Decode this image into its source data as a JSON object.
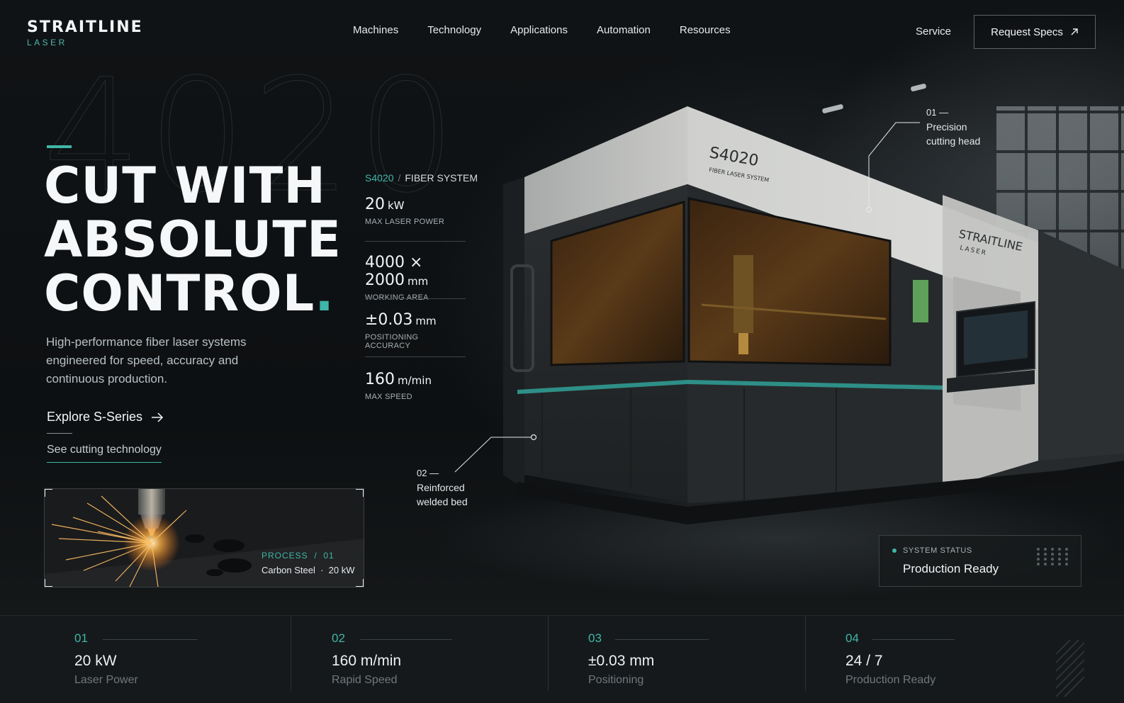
{
  "brand": {
    "name": "STRAITLINE",
    "sub": "LASER"
  },
  "nav": {
    "items": [
      "Machines",
      "Technology",
      "Applications",
      "Automation",
      "Resources"
    ],
    "service": "Service",
    "cta": "Request Specs"
  },
  "hero": {
    "watermark": "4020",
    "headline": [
      "CUT WITH",
      "ABSOLUTE",
      "CONTROL"
    ],
    "headline_dot": ".",
    "subtext": "High-performance fiber laser systems engineered for speed, accuracy and continuous production.",
    "cta_primary": "Explore S-Series",
    "cta_secondary": "See cutting technology"
  },
  "process": {
    "label": "PROCESS  /  01",
    "value": "Carbon Steel  ·  20 kW"
  },
  "specs": {
    "model": "S4020",
    "system": "FIBER SYSTEM",
    "items": [
      {
        "value": "20",
        "unit": "kW",
        "label": "MAX LASER POWER"
      },
      {
        "value": "4000 × 2000",
        "unit": "mm",
        "label": "WORKING AREA"
      },
      {
        "value": "±0.03",
        "unit": "mm",
        "label": "POSITIONING ACCURACY"
      },
      {
        "value": "160",
        "unit": "m/min",
        "label": "MAX SPEED"
      }
    ]
  },
  "machine": {
    "model_label": "S4020",
    "model_sub": "FIBER LASER SYSTEM",
    "brand_label": "STRAITLINE",
    "brand_sub": "LASER"
  },
  "callouts": [
    {
      "num": "01 —",
      "text": [
        "Precision",
        "cutting head"
      ]
    },
    {
      "num": "02 —",
      "text": [
        "Reinforced",
        "welded bed"
      ]
    }
  ],
  "status": {
    "label": "SYSTEM STATUS",
    "value": "Production Ready"
  },
  "stats": [
    {
      "num": "01",
      "value": "20 kW",
      "label": "Laser Power"
    },
    {
      "num": "02",
      "value": "160 m/min",
      "label": "Rapid Speed"
    },
    {
      "num": "03",
      "value": "±0.03 mm",
      "label": "Positioning"
    },
    {
      "num": "04",
      "value": "24 / 7",
      "label": "Production Ready"
    }
  ],
  "colors": {
    "accent": "#3fb6a8",
    "background": "#0c0e10",
    "text": "#f2f4f5"
  }
}
